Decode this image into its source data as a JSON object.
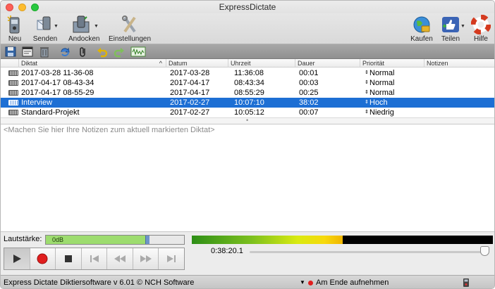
{
  "window": {
    "title": "ExpressDictate"
  },
  "toolbar": {
    "new_label": "Neu",
    "send_label": "Senden",
    "dock_label": "Andocken",
    "settings_label": "Einstellungen",
    "buy_label": "Kaufen",
    "share_label": "Teilen",
    "help_label": "Hilfe"
  },
  "table": {
    "columns": [
      "Diktat",
      "Datum",
      "Uhrzeit",
      "Dauer",
      "Priorität",
      "Notizen"
    ],
    "rows": [
      {
        "name": "2017-03-28 11-36-08",
        "date": "2017-03-28",
        "time": "11:36:08",
        "duration": "00:01",
        "priority": "Normal",
        "selected": false
      },
      {
        "name": "2017-04-17 08-43-34",
        "date": "2017-04-17",
        "time": "08:43:34",
        "duration": "00:03",
        "priority": "Normal",
        "selected": false
      },
      {
        "name": "2017-04-17 08-55-29",
        "date": "2017-04-17",
        "time": "08:55:29",
        "duration": "00:25",
        "priority": "Normal",
        "selected": false
      },
      {
        "name": "Interview",
        "date": "2017-02-27",
        "time": "10:07:10",
        "duration": "38:02",
        "priority": "Hoch",
        "selected": true
      },
      {
        "name": "Standard-Projekt",
        "date": "2017-02-27",
        "time": "10:05:12",
        "duration": "00:07",
        "priority": "Niedrig",
        "selected": false
      }
    ]
  },
  "notes": {
    "placeholder": "<Machen Sie hier Ihre Notizen zum aktuell markierten Diktat>"
  },
  "volume": {
    "label": "Lautstärke:",
    "value_text": "0dB",
    "level": 0.72
  },
  "meter": {
    "level": 0.5
  },
  "playback": {
    "position_text": "0:38:20.1",
    "progress": 1.0
  },
  "status": {
    "left_text": "Express Dictate Diktiersoftware v 6.01 © NCH Software",
    "mode_text": "Am Ende aufnehmen"
  },
  "colors": {
    "selection": "#1d6fd4",
    "record": "#e01e1e",
    "meter_bg": "#000000"
  }
}
